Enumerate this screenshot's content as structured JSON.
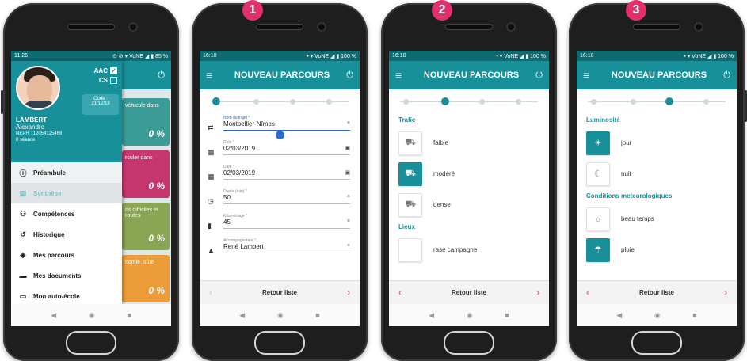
{
  "colors": {
    "teal": "#17909a",
    "teal_dark": "#0e6b72",
    "badge": "#e3306a",
    "link_blue": "#2c6bd6"
  },
  "badges": [
    "1",
    "2",
    "3"
  ],
  "screen1": {
    "status_time": "11:26",
    "status_right": "⊙ ⊘ ▾ VoNE ◢ ▮ 85 %",
    "checks": [
      {
        "label": "AAC",
        "checked": true
      },
      {
        "label": "CS",
        "checked": false
      }
    ],
    "code_label": "Code :",
    "code_date": "21/12/18",
    "last_name": "LAMBERT",
    "first_name": "Alexandre",
    "neph": "NEPH : 12054125468",
    "seance": "0 séance",
    "menu": [
      {
        "label": "Préambule",
        "icon": "info-icon"
      },
      {
        "label": "Synthèse",
        "icon": "chart-icon"
      },
      {
        "label": "Compétences",
        "icon": "people-icon"
      },
      {
        "label": "Historique",
        "icon": "history-icon"
      },
      {
        "label": "Mes parcours",
        "icon": "compass-icon"
      },
      {
        "label": "Mes documents",
        "icon": "folder-icon"
      },
      {
        "label": "Mon auto-école",
        "icon": "school-icon"
      }
    ],
    "bg_cards": [
      {
        "text": "véhicule dans",
        "pct": "0 %",
        "color": "#1f8f8a"
      },
      {
        "text": "rculer dans",
        "pct": "0 %",
        "color": "#c2185b"
      },
      {
        "text": "ns difficiles et routes",
        "pct": "0 %",
        "color": "#7c9a3a"
      },
      {
        "text": "nomie, sûre",
        "pct": "0 %",
        "color": "#ef8f1b"
      }
    ]
  },
  "common": {
    "status_time": "16:10",
    "status_right": "• ▾ VoNE ◢ ▮ 100 %",
    "app_title": "NOUVEAU PARCOURS",
    "menu_icon": "≡",
    "power_icon": "⏻",
    "back_label": "Retour liste",
    "prev_arrow": "‹",
    "next_arrow": "›",
    "sysnav": [
      "◀",
      "◉",
      "■"
    ]
  },
  "screen2": {
    "fields": [
      {
        "label": "Nom du trajet *",
        "value": "Montpellier-Nîmes",
        "end": "×",
        "icon": "route-icon",
        "glyph": "⇄"
      },
      {
        "label": "Date *",
        "value": "02/03/2019",
        "end": "▣",
        "icon": "calendar-icon",
        "glyph": "▦"
      },
      {
        "label": "Date *",
        "value": "02/03/2019",
        "end": "▣",
        "icon": "calendar-icon",
        "glyph": "▦"
      },
      {
        "label": "Durée (min) *",
        "value": "50",
        "end": "×",
        "icon": "clock-icon",
        "glyph": "◷"
      },
      {
        "label": "Kilométrage *",
        "value": "45",
        "end": "×",
        "icon": "fuel-icon",
        "glyph": "▮"
      },
      {
        "label": "Accompagnateur *",
        "value": "René Lambert",
        "end": "×",
        "icon": "graduation-icon",
        "glyph": "▲"
      }
    ]
  },
  "screen3": {
    "section_trafic": "Trafic",
    "trafic": [
      {
        "label": "faible",
        "on": false
      },
      {
        "label": "modéré",
        "on": true
      },
      {
        "label": "dense",
        "on": false
      }
    ],
    "section_lieux": "Lieux",
    "lieux": [
      {
        "label": "rase campagne",
        "on": false
      }
    ]
  },
  "screen4": {
    "section_lum": "Luminosité",
    "lum": [
      {
        "label": "jour",
        "on": true,
        "glyph": "☀"
      },
      {
        "label": "nuit",
        "on": false,
        "glyph": "☾"
      }
    ],
    "section_meteo": "Conditions meteorologiques",
    "meteo": [
      {
        "label": "beau temps",
        "on": false,
        "glyph": "☼"
      },
      {
        "label": "pluie",
        "on": true,
        "glyph": "☂"
      }
    ]
  }
}
